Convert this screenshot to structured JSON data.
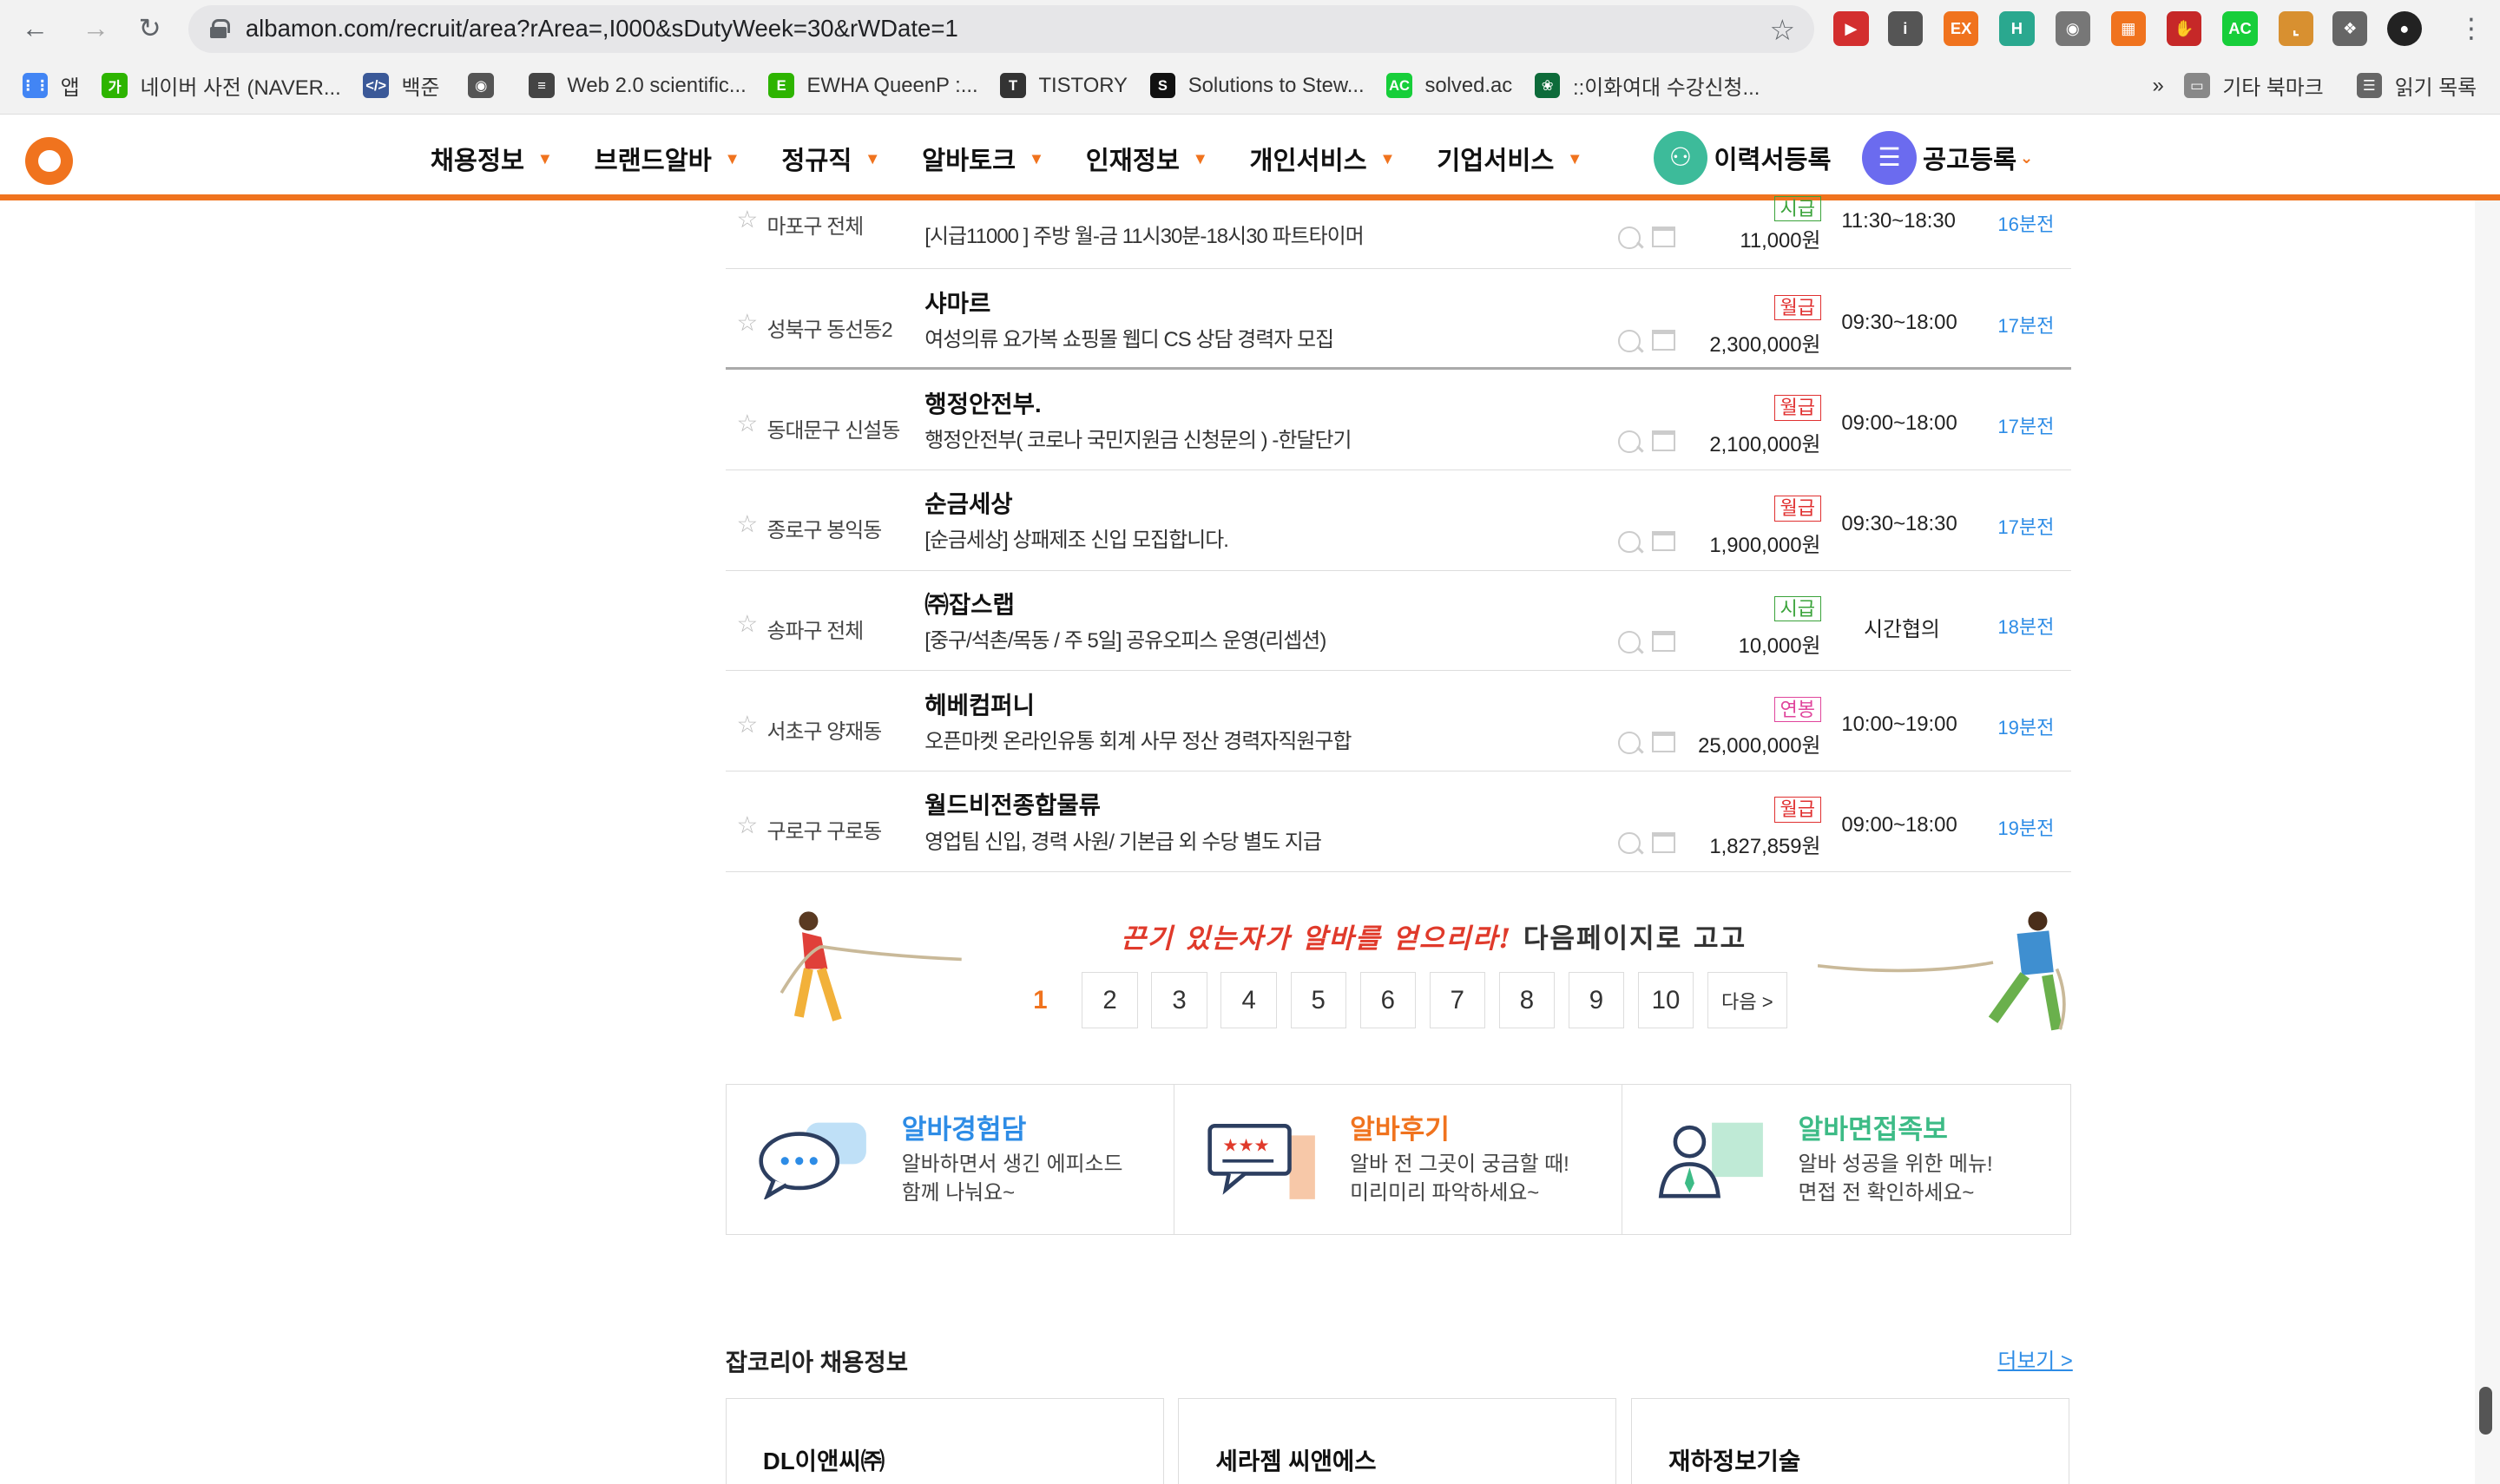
{
  "browser": {
    "url": "albamon.com/recruit/area?rArea=,I000&sDutyWeek=30&rWDate=1",
    "bookmarks": [
      {
        "label": "앱",
        "icon": "apps-grid-icon",
        "color": "#4285f4"
      },
      {
        "label": "네이버 사전 (NAVER...",
        "icon": "naver-dict-icon",
        "color": "#2db400"
      },
      {
        "label": "백준",
        "icon": "code-icon",
        "color": "#3b5998"
      },
      {
        "label": "",
        "icon": "globe-icon",
        "color": "#555555"
      },
      {
        "label": "Web 2.0 scientific...",
        "icon": "calc-icon",
        "color": "#444444"
      },
      {
        "label": "EWHA QueenP :...",
        "icon": "ewha-icon",
        "color": "#2db400"
      },
      {
        "label": "TISTORY",
        "icon": "tistory-icon",
        "color": "#333333"
      },
      {
        "label": "Solutions to Stew...",
        "icon": "s-icon",
        "color": "#111111"
      },
      {
        "label": "solved.ac",
        "icon": "ac-icon",
        "color": "#17ce3a"
      },
      {
        "label": "::이화여대 수강신청...",
        "icon": "ewha-seal-icon",
        "color": "#0d6b3a"
      }
    ],
    "more": "»",
    "other_bookmarks": "기타 북마크",
    "reading_list": "읽기 목록"
  },
  "nav": {
    "items": [
      "채용정보",
      "브랜드알바",
      "정규직",
      "알바토크",
      "인재정보",
      "개인서비스",
      "기업서비스"
    ],
    "resume_btn": "이력서등록",
    "post_btn": "공고등록"
  },
  "jobs": [
    {
      "area": "마포구 전체",
      "company": "",
      "title": "[시급11000 ] 주방 월-금 11시30분-18시30 파트타이머",
      "pay_type": "시급",
      "pay_class": "hourly",
      "pay": "11,000원",
      "time": "11:30~18:30",
      "ago": "16분전"
    },
    {
      "area": "성북구 동선동2",
      "company": "샤마르",
      "title": "여성의류 요가복 쇼핑몰 웹디 CS 상담 경력자 모집",
      "pay_type": "월급",
      "pay_class": "monthly",
      "pay": "2,300,000원",
      "time": "09:30~18:00",
      "ago": "17분전"
    },
    {
      "area": "동대문구 신설동",
      "company": "행정안전부.",
      "title": "행정안전부( 코로나 국민지원금 신청문의 ) -한달단기",
      "pay_type": "월급",
      "pay_class": "monthly",
      "pay": "2,100,000원",
      "time": "09:00~18:00",
      "ago": "17분전"
    },
    {
      "area": "종로구 봉익동",
      "company": "순금세상",
      "title": "[순금세상] 상패제조 신입 모집합니다.",
      "pay_type": "월급",
      "pay_class": "monthly",
      "pay": "1,900,000원",
      "time": "09:30~18:30",
      "ago": "17분전"
    },
    {
      "area": "송파구 전체",
      "company": "㈜잡스랩",
      "title": "[중구/석촌/목동 / 주 5일] 공유오피스 운영(리셉션)",
      "pay_type": "시급",
      "pay_class": "hourly",
      "pay": "10,000원",
      "time": "시간협의",
      "ago": "18분전"
    },
    {
      "area": "서초구 양재동",
      "company": "헤베컴퍼니",
      "title": "오픈마켓 온라인유통 회계 사무 정산 경력자직원구합",
      "pay_type": "연봉",
      "pay_class": "yearly",
      "pay": "25,000,000원",
      "time": "10:00~19:00",
      "ago": "19분전"
    },
    {
      "area": "구로구 구로동",
      "company": "월드비전종합물류",
      "title": "영업팀 신입, 경력 사원/ 기본급 외 수당 별도 지급",
      "pay_type": "월급",
      "pay_class": "monthly",
      "pay": "1,827,859원",
      "time": "09:00~18:00",
      "ago": "19분전"
    }
  ],
  "pager": {
    "slogan_red": "끈기 있는자가 알바를 얻으리라!",
    "slogan_dark": "다음페이지로 고고",
    "pages": [
      "1",
      "2",
      "3",
      "4",
      "5",
      "6",
      "7",
      "8",
      "9",
      "10"
    ],
    "next": "다음 >"
  },
  "banners": [
    {
      "title": "알바경험담",
      "desc1": "알바하면서 생긴 에피소드",
      "desc2": "함께 나눠요~",
      "color": "#2d8ce6",
      "icon": "speech-bubble-icon"
    },
    {
      "title": "알바후기",
      "desc1": "알바 전 그곳이 궁금할 때!",
      "desc2": "미리미리 파악하세요~",
      "color": "#f0731e",
      "icon": "review-board-icon"
    },
    {
      "title": "알바면접족보",
      "desc1": "알바 성공을 위한 메뉴!",
      "desc2": "면접 전 확인하세요~",
      "color": "#3dbb86",
      "icon": "interview-person-icon"
    }
  ],
  "jobkorea": {
    "title": "잡코리아 채용정보",
    "more": "더보기 >",
    "cards": [
      "DL이앤씨㈜",
      "세라젬 씨앤에스",
      "재하정보기술"
    ]
  }
}
